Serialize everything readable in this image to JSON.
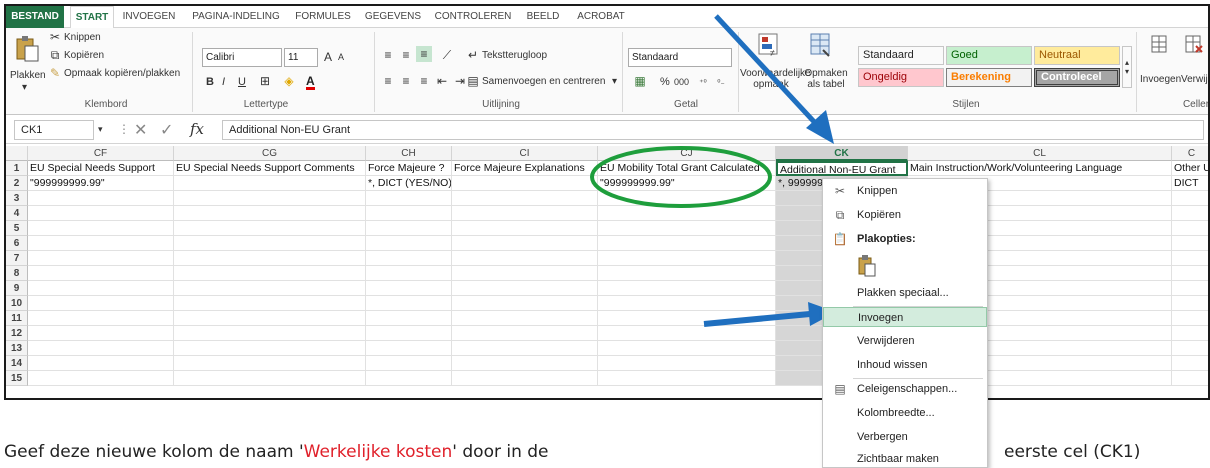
{
  "ribbon_tabs": [
    "BESTAND",
    "START",
    "INVOEGEN",
    "PAGINA-INDELING",
    "FORMULES",
    "GEGEVENS",
    "CONTROLEREN",
    "BEELD",
    "ACROBAT"
  ],
  "clipboard": {
    "paste": "Plakken",
    "cut": "Knippen",
    "copy": "Kopiëren",
    "format_painter": "Opmaak kopiëren/plakken",
    "group": "Klembord"
  },
  "font": {
    "name": "Calibri",
    "size": "11",
    "bold": "B",
    "italic": "I",
    "underline": "U",
    "grow": "A",
    "shrink": "A",
    "color_letter": "A",
    "group": "Lettertype"
  },
  "alignment": {
    "wrap": "Tekstterugloop",
    "merge": "Samenvoegen en centreren",
    "group": "Uitlijning"
  },
  "number": {
    "format": "Standaard",
    "percent": "%",
    "thousands": "000",
    "inc_decimals": ",0\n,00",
    "dec_decimals": ",00\n,0",
    "group": "Getal"
  },
  "styles": {
    "conditional": "Voorwaardelijke opmaak",
    "format_table": "Opmaken als tabel",
    "cells": [
      {
        "label": "Standaard",
        "bg": "#ffffff",
        "fg": "#000000"
      },
      {
        "label": "Goed",
        "bg": "#c6efce",
        "fg": "#006100"
      },
      {
        "label": "Neutraal",
        "bg": "#ffeb9c",
        "fg": "#9c5700"
      },
      {
        "label": "Ongeldig",
        "bg": "#ffc7ce",
        "fg": "#9c0006"
      },
      {
        "label": "Berekening",
        "bg": "#f2f2f2",
        "fg": "#fa7d00"
      },
      {
        "label": "Controlecel",
        "bg": "#a5a5a5",
        "fg": "#ffffff"
      }
    ],
    "group": "Stijlen"
  },
  "cells_group": {
    "insert": "Invoegen",
    "delete": "Verwijde",
    "group": "Celler"
  },
  "formula_bar": {
    "name_box": "CK1",
    "fx": "fx",
    "content": "Additional Non-EU Grant"
  },
  "columns": [
    {
      "letter": "CF",
      "header": "EU Special Needs Support",
      "row2": "\"999999999.99\""
    },
    {
      "letter": "CG",
      "header": "EU Special Needs Support Comments",
      "row2": ""
    },
    {
      "letter": "CH",
      "header": "Force Majeure ?",
      "row2": "*, DICT (YES/NO)"
    },
    {
      "letter": "CI",
      "header": "Force Majeure Explanations",
      "row2": ""
    },
    {
      "letter": "CJ",
      "header": "EU Mobility Total Grant Calculated",
      "row2": "\"999999999.99\""
    },
    {
      "letter": "CK",
      "header": "Additional Non-EU Grant",
      "row2": "*, 999999"
    },
    {
      "letter": "CL",
      "header": "Main Instruction/Work/Volunteering Language",
      "row2": ""
    },
    {
      "letter": "C",
      "header": "Other Used",
      "row2": "DICT"
    }
  ],
  "row_numbers": [
    "1",
    "2",
    "3",
    "4",
    "5",
    "6",
    "7",
    "8",
    "9",
    "10",
    "11",
    "12",
    "13",
    "14",
    "15"
  ],
  "context_menu": {
    "cut": "Knippen",
    "copy": "Kopiëren",
    "paste_options": "Plakopties:",
    "paste_special": "Plakken speciaal...",
    "insert": "Invoegen",
    "delete": "Verwijderen",
    "clear": "Inhoud wissen",
    "format_cells": "Celeigenschappen...",
    "col_width": "Kolombreedte...",
    "hide": "Verbergen",
    "unhide": "Zichtbaar maken"
  },
  "caption": {
    "before": "Geef deze nieuwe kolom de naam '",
    "highlight": "Werkelijke kosten",
    "after": "' door in de",
    "tail": "eerste cel (CK1)"
  },
  "colors": {
    "excel_green": "#217346",
    "annotation_blue": "#1f6fbf",
    "annotation_green": "#1e9e3c",
    "caption_red": "#e0202a"
  }
}
